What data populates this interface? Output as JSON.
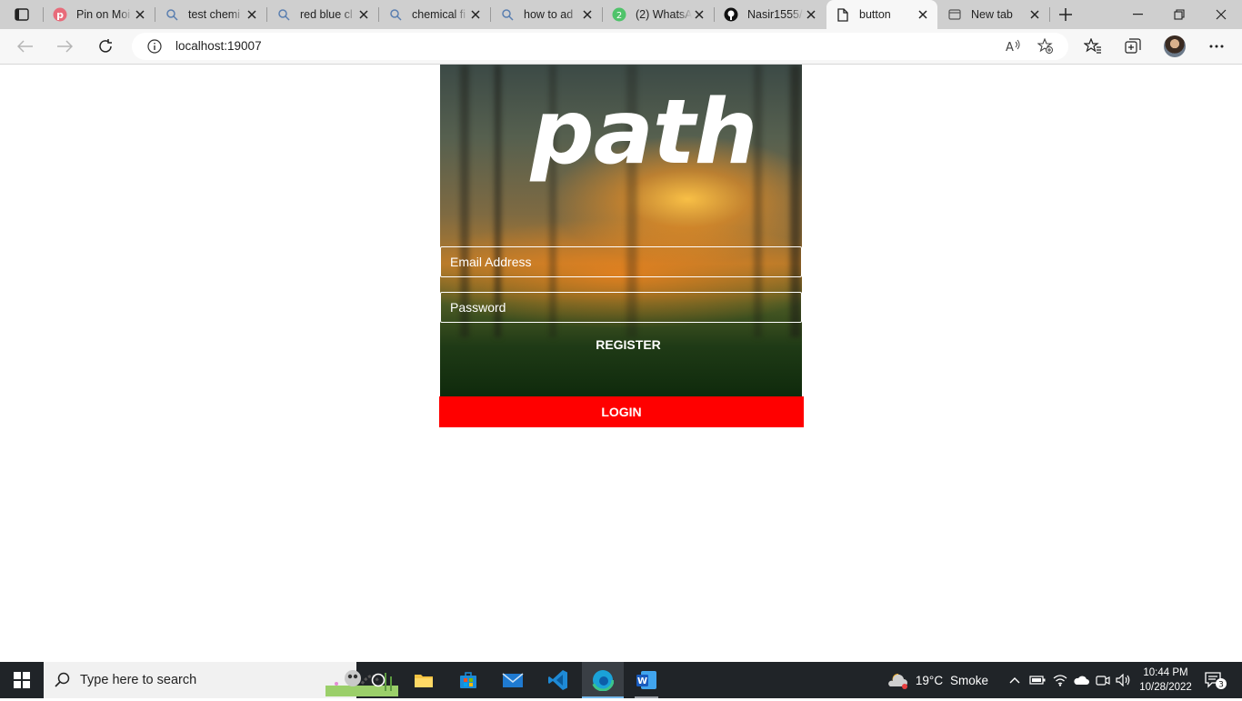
{
  "browser": {
    "tabs": [
      {
        "title": "Pin on Moi",
        "icon": "pinterest-icon",
        "active": false
      },
      {
        "title": "test chemi",
        "icon": "search-icon",
        "active": false
      },
      {
        "title": "red blue cl",
        "icon": "search-icon",
        "active": false
      },
      {
        "title": "chemical fi",
        "icon": "search-icon",
        "active": false
      },
      {
        "title": "how to ad",
        "icon": "search-icon",
        "active": false
      },
      {
        "title": "(2) WhatsA",
        "icon": "whatsapp-icon",
        "badge": "2",
        "active": false
      },
      {
        "title": "Nasir1555/",
        "icon": "github-icon",
        "active": false
      },
      {
        "title": "button",
        "icon": "page-icon",
        "active": true
      },
      {
        "title": "New tab",
        "icon": "newtab-icon",
        "active": false
      }
    ],
    "address": "localhost:19007",
    "colors": {
      "tabbar": "#cfcfcf",
      "toolbar": "#f7f7f7"
    }
  },
  "page": {
    "brand_text": "path",
    "email_placeholder": "Email Address",
    "password_placeholder": "Password",
    "register_label": "REGISTER",
    "login_label": "LOGIN",
    "colors": {
      "login_button": "#ff0000",
      "text": "#ffffff"
    }
  },
  "taskbar": {
    "search_placeholder": "Type here to search",
    "weather": {
      "temp": "19°C",
      "condition": "Smoke"
    },
    "time": "10:44 PM",
    "date": "10/28/2022",
    "notification_count": "3",
    "apps": [
      "task-view-icon",
      "file-explorer-icon",
      "microsoft-store-icon",
      "mail-icon",
      "vscode-icon",
      "edge-icon",
      "word-icon"
    ]
  }
}
